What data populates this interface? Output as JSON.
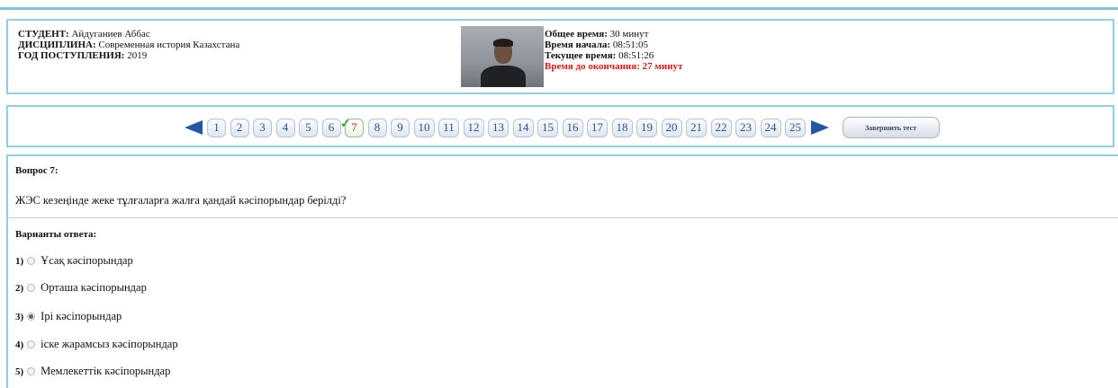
{
  "student": {
    "student_label": "СТУДЕНТ:",
    "student_name": "Айдуганиев Аббас",
    "discipline_label": "ДИСЦИПЛИНА:",
    "discipline_value": "Современная история Казахстана",
    "year_label": "ГОД ПОСТУПЛЕНИЯ:",
    "year_value": "2019"
  },
  "timer": {
    "total_label": "Общее время:",
    "total_value": "30 минут",
    "start_label": "Время начала:",
    "start_value": "08:51:05",
    "current_label": "Текущее время:",
    "current_value": "08:51:26",
    "remaining_text": "Время до окончания: 27 минут"
  },
  "pager": {
    "pages": [
      "1",
      "2",
      "3",
      "4",
      "5",
      "6",
      "7",
      "8",
      "9",
      "10",
      "11",
      "12",
      "13",
      "14",
      "15",
      "16",
      "17",
      "18",
      "19",
      "20",
      "21",
      "22",
      "23",
      "24",
      "25"
    ],
    "current": "7",
    "finish_label": "Завершить тест"
  },
  "question": {
    "label": "Вопрос 7:",
    "text": "ЖЭС кезеңінде жеке тұлғаларға жалға қандай кәсіпорындар берілді?",
    "options_label": "Варианты ответа:",
    "options": [
      {
        "num": "1)",
        "text": "Ұсақ кәсіпорындар",
        "checked": false
      },
      {
        "num": "2)",
        "text": "Орташа кәсіпорындар",
        "checked": false
      },
      {
        "num": "3)",
        "text": "Ірі кәсіпорындар",
        "checked": true
      },
      {
        "num": "4)",
        "text": "іске жарамсыз кәсіпорындар",
        "checked": false
      },
      {
        "num": "5)",
        "text": "Мемлекеттік кәсіпорындар",
        "checked": false
      }
    ]
  },
  "colors": {
    "panel_border": "#8fd0e3",
    "accent": "#2357a6",
    "alert": "#e01414"
  }
}
